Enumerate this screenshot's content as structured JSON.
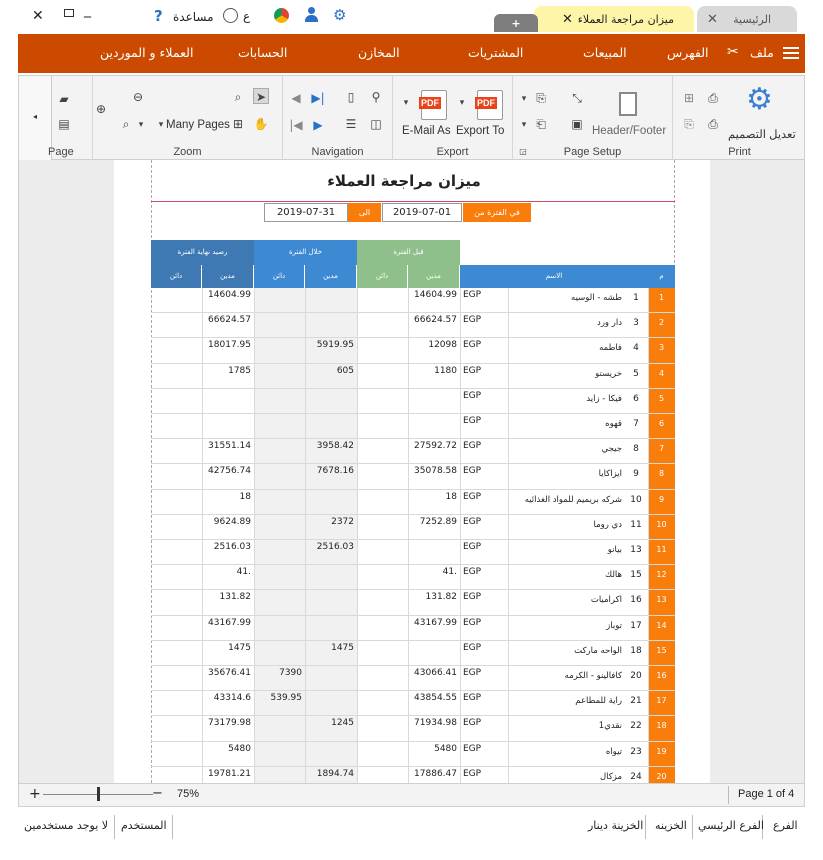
{
  "titlebar": {
    "tab_home": "الرئيسية",
    "tab_report": "ميزان مراجعة العملاء",
    "help_label": "مساعدة",
    "lang_label": "ع",
    "close_glyph": "✕",
    "add_glyph": "+"
  },
  "menu": {
    "file": "ملف",
    "index": "الفهرس",
    "sales": "المبيعات",
    "purchases": "المشتريات",
    "stores": "المخازن",
    "accounts": "الحسابات",
    "customers_suppliers": "العملاء و الموردين"
  },
  "ribbon": {
    "print_group": "Print",
    "edit_design": "تعديل التصميم",
    "page_setup_group": "Page Setup",
    "header_footer": "Header/Footer",
    "export_group": "Export",
    "email_as": "E-Mail As",
    "export_to": "Export To",
    "pdf_badge": "PDF",
    "navigation_group": "Navigation",
    "zoom_group": "Zoom",
    "many_pages": "Many Pages",
    "page_group": "Page"
  },
  "report": {
    "title": "ميزان مراجعة العملاء",
    "period_label": "في الفترة من",
    "from_date": "2019-07-01",
    "to_label": "الى",
    "to_date": "2019-07-31",
    "hdr_before": "قبل الفترة",
    "hdr_during": "خلال الفترة",
    "hdr_balance": "رصيد نهاية الفترة",
    "col_debit": "مدين",
    "col_credit": "دائن",
    "col_name": "الاسم",
    "col_m": "م",
    "rows": [
      {
        "n": "1",
        "code": "1",
        "name": "طشه - الوسيه",
        "cur": "EGP",
        "bd": "14604.99",
        "bc": "",
        "dd": "",
        "dc": "",
        "ed": "14604.99",
        "ec": ""
      },
      {
        "n": "2",
        "code": "3",
        "name": "دار ورد",
        "cur": "EGP",
        "bd": "66624.57",
        "bc": "",
        "dd": "",
        "dc": "",
        "ed": "66624.57",
        "ec": ""
      },
      {
        "n": "3",
        "code": "4",
        "name": "فاطمه",
        "cur": "EGP",
        "bd": "12098",
        "bc": "",
        "dd": "5919.95",
        "dc": "",
        "ed": "18017.95",
        "ec": ""
      },
      {
        "n": "4",
        "code": "5",
        "name": "خريستو",
        "cur": "EGP",
        "bd": "1180",
        "bc": "",
        "dd": "605",
        "dc": "",
        "ed": "1785",
        "ec": ""
      },
      {
        "n": "5",
        "code": "6",
        "name": "فيكا - زايد",
        "cur": "EGP",
        "bd": "",
        "bc": "",
        "dd": "",
        "dc": "",
        "ed": "",
        "ec": ""
      },
      {
        "n": "6",
        "code": "7",
        "name": "قهوه",
        "cur": "EGP",
        "bd": "",
        "bc": "",
        "dd": "",
        "dc": "",
        "ed": "",
        "ec": ""
      },
      {
        "n": "7",
        "code": "8",
        "name": "جيجي",
        "cur": "EGP",
        "bd": "27592.72",
        "bc": "",
        "dd": "3958.42",
        "dc": "",
        "ed": "31551.14",
        "ec": ""
      },
      {
        "n": "8",
        "code": "9",
        "name": "ايزاكايا",
        "cur": "EGP",
        "bd": "35078.58",
        "bc": "",
        "dd": "7678.16",
        "dc": "",
        "ed": "42756.74",
        "ec": ""
      },
      {
        "n": "9",
        "code": "10",
        "name": "شركه بريميم للمواد الغذائيه",
        "cur": "EGP",
        "bd": "18",
        "bc": "",
        "dd": "",
        "dc": "",
        "ed": "18",
        "ec": ""
      },
      {
        "n": "10",
        "code": "11",
        "name": "دي روما",
        "cur": "EGP",
        "bd": "7252.89",
        "bc": "",
        "dd": "2372",
        "dc": "",
        "ed": "9624.89",
        "ec": ""
      },
      {
        "n": "11",
        "code": "13",
        "name": "بيانو",
        "cur": "EGP",
        "bd": "",
        "bc": "",
        "dd": "2516.03",
        "dc": "",
        "ed": "2516.03",
        "ec": ""
      },
      {
        "n": "12",
        "code": "15",
        "name": "هالك",
        "cur": "EGP",
        "bd": "41.",
        "bc": "",
        "dd": "",
        "dc": "",
        "ed": "41.",
        "ec": ""
      },
      {
        "n": "13",
        "code": "16",
        "name": "اكراميات",
        "cur": "EGP",
        "bd": "131.82",
        "bc": "",
        "dd": "",
        "dc": "",
        "ed": "131.82",
        "ec": ""
      },
      {
        "n": "14",
        "code": "17",
        "name": "توباز",
        "cur": "EGP",
        "bd": "43167.99",
        "bc": "",
        "dd": "",
        "dc": "",
        "ed": "43167.99",
        "ec": ""
      },
      {
        "n": "15",
        "code": "18",
        "name": "الواحه ماركت",
        "cur": "EGP",
        "bd": "",
        "bc": "",
        "dd": "1475",
        "dc": "",
        "ed": "1475",
        "ec": ""
      },
      {
        "n": "16",
        "code": "20",
        "name": "كافالينو - الكرمه",
        "cur": "EGP",
        "bd": "43066.41",
        "bc": "",
        "dd": "",
        "dc": "7390",
        "ed": "35676.41",
        "ec": ""
      },
      {
        "n": "17",
        "code": "21",
        "name": "راية للمطاعم",
        "cur": "EGP",
        "bd": "43854.55",
        "bc": "",
        "dd": "",
        "dc": "539.95",
        "ed": "43314.6",
        "ec": ""
      },
      {
        "n": "18",
        "code": "22",
        "name": "نقدي1",
        "cur": "EGP",
        "bd": "71934.98",
        "bc": "",
        "dd": "1245",
        "dc": "",
        "ed": "73179.98",
        "ec": ""
      },
      {
        "n": "19",
        "code": "23",
        "name": "تيواه",
        "cur": "EGP",
        "bd": "5480",
        "bc": "",
        "dd": "",
        "dc": "",
        "ed": "5480",
        "ec": ""
      },
      {
        "n": "20",
        "code": "24",
        "name": "مزكال",
        "cur": "EGP",
        "bd": "17886.47",
        "bc": "",
        "dd": "1894.74",
        "dc": "",
        "ed": "19781.21",
        "ec": ""
      }
    ]
  },
  "zoombar": {
    "zoom_level": "75%",
    "zoom_fraction": 0.49,
    "page_status": "Page 1 of 4",
    "minus": "−",
    "plus": "+"
  },
  "footer": {
    "branch_label": "الفرع",
    "main_branch": "الفرع الرئيسي",
    "treasury_label": "الخزينه",
    "treasury_value": "الخزينة دينار",
    "user_label": "المستخدم",
    "no_users": "لا يوجد مستخدمين"
  },
  "colors": {
    "menu_bg": "#cb4a00",
    "orange": "#f97d0b",
    "blue_header": "#3d8ad3",
    "green_header": "#8fc08b",
    "balance_header": "#3f79b4",
    "tab_active": "#fff5a8"
  }
}
